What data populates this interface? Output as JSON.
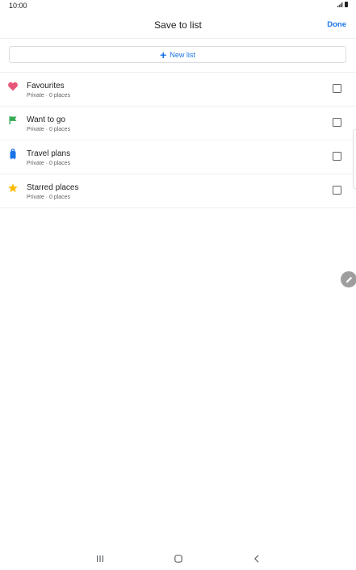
{
  "status_bar": {
    "time": "10:00"
  },
  "header": {
    "title": "Save to list",
    "done_label": "Done"
  },
  "new_list": {
    "label": "New list"
  },
  "lists": [
    {
      "name": "Favourites",
      "sub": "Private · 0 places",
      "icon": "heart-icon",
      "color": "#e8577a"
    },
    {
      "name": "Want to go",
      "sub": "Private · 0 places",
      "icon": "flag-icon",
      "color": "#34a853"
    },
    {
      "name": "Travel plans",
      "sub": "Private · 0 places",
      "icon": "suitcase-icon",
      "color": "#1a73e8"
    },
    {
      "name": "Starred places",
      "sub": "Private · 0 places",
      "icon": "star-icon",
      "color": "#fbbc04"
    }
  ],
  "colors": {
    "accent": "#1a73e8",
    "text": "#202124",
    "secondary": "#5f6368"
  }
}
